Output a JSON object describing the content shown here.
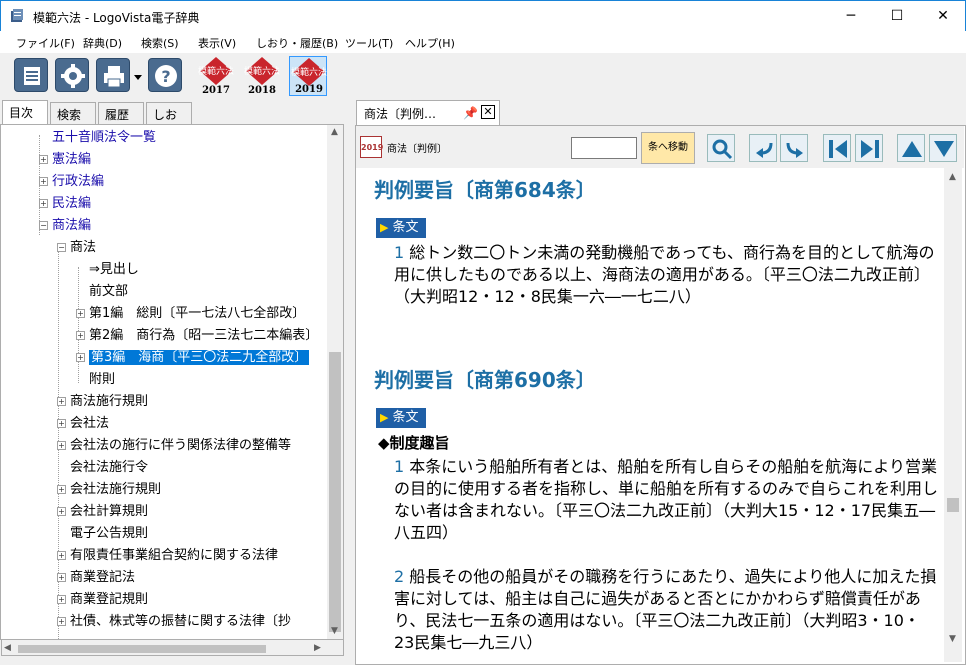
{
  "window": {
    "title": "模範六法 - LogoVista電子辞典",
    "minimize_label": "─",
    "maximize_label": "☐",
    "close_label": "✕"
  },
  "menu": [
    "ファイル(F)",
    "辞典(D)",
    "検索(S)",
    "表示(V)",
    "しおり・履歴(B)",
    "ツール(T)",
    "ヘルプ(H)"
  ],
  "toolbar": {
    "buttons": [
      "list-icon",
      "settings-gear-icon",
      "printer-icon",
      "dropdown-arrow-icon",
      "help-icon"
    ],
    "books": [
      {
        "label": "模範六法",
        "year": "2017"
      },
      {
        "label": "模範六法",
        "year": "2018"
      },
      {
        "label": "模範六法",
        "year": "2019",
        "selected": true
      }
    ]
  },
  "left_tabs": [
    "目次",
    "検索",
    "履歴",
    "しおり"
  ],
  "tree": {
    "items": [
      {
        "label": "五十音順法令一覧",
        "level": 0,
        "expander": "none",
        "blue": true
      },
      {
        "label": "憲法編",
        "level": 0,
        "expander": "+",
        "blue": true
      },
      {
        "label": "行政法編",
        "level": 0,
        "expander": "+",
        "blue": true
      },
      {
        "label": "民法編",
        "level": 0,
        "expander": "+",
        "blue": true
      },
      {
        "label": "商法編",
        "level": 0,
        "expander": "-",
        "blue": true
      },
      {
        "label": "商法",
        "level": 1,
        "expander": "-"
      },
      {
        "label": "⇒見出し",
        "level": 2,
        "expander": "none"
      },
      {
        "label": "前文部",
        "level": 2,
        "expander": "none"
      },
      {
        "label": "第1編　総則〔平一七法八七全部改〕",
        "level": 2,
        "expander": "+"
      },
      {
        "label": "第2編　商行為〔昭一三法七二本編表〕",
        "level": 2,
        "expander": "+"
      },
      {
        "label": "第3編　海商〔平三〇法二九全部改〕",
        "level": 2,
        "expander": "+",
        "selected": true
      },
      {
        "label": "附則",
        "level": 2,
        "expander": "none"
      },
      {
        "label": "商法施行規則",
        "level": 1,
        "expander": "+"
      },
      {
        "label": "会社法",
        "level": 1,
        "expander": "+"
      },
      {
        "label": "会社法の施行に伴う関係法律の整備等",
        "level": 1,
        "expander": "+"
      },
      {
        "label": "会社法施行令",
        "level": 1,
        "expander": "none"
      },
      {
        "label": "会社法施行規則",
        "level": 1,
        "expander": "+"
      },
      {
        "label": "会社計算規則",
        "level": 1,
        "expander": "+"
      },
      {
        "label": "電子公告規則",
        "level": 1,
        "expander": "none"
      },
      {
        "label": "有限責任事業組合契約に関する法律",
        "level": 1,
        "expander": "+"
      },
      {
        "label": "商業登記法",
        "level": 1,
        "expander": "+"
      },
      {
        "label": "商業登記規則",
        "level": 1,
        "expander": "+"
      },
      {
        "label": "社債、株式等の振替に関する法律〔抄",
        "level": 1,
        "expander": "+"
      }
    ]
  },
  "doc_tab": {
    "label": "商法〔判例…",
    "close": "✕"
  },
  "doc_toolbar": {
    "book_icon": "2019",
    "book_label": "商法〔判例〕",
    "jump_value": "",
    "jump_button": "条へ移動"
  },
  "document": {
    "sections": [
      {
        "heading": "判例要旨〔商第684条〕",
        "tag": "条文",
        "subheading": "",
        "paras": [
          {
            "num": "1",
            "text": " 総トン数二〇トン未満の発動機船であっても、商行為を目的として航海の用に供したものである以上、海商法の適用がある。〔平三〇法二九改正前〕（大判昭12・12・8民集一六―一七二八）"
          }
        ]
      },
      {
        "heading": "判例要旨〔商第690条〕",
        "tag": "条文",
        "subheading": "◆制度趣旨",
        "paras": [
          {
            "num": "1",
            "text": " 本条にいう船舶所有者とは、船舶を所有し自らその船舶を航海により営業の目的に使用する者を指称し、単に船舶を所有するのみで自らこれを利用しない者は含まれない。〔平三〇法二九改正前〕（大判大15・12・17民集五―八五四）"
          },
          {
            "num": "2",
            "text": " 船長その他の船員がその職務を行うにあたり、過失により他人に加えた損害に対しては、船主は自己に過失があると否とにかかわらず賠償責任があり、民法七一五条の適用はない。〔平三〇法二九改正前〕（大判昭3・10・23民集七―九三八）"
          }
        ]
      }
    ]
  },
  "colors": {
    "heading": "#1d6fa5",
    "tag_bg": "#1f5fa6",
    "selection": "#0078d7",
    "tree_link": "#1a0dab"
  }
}
